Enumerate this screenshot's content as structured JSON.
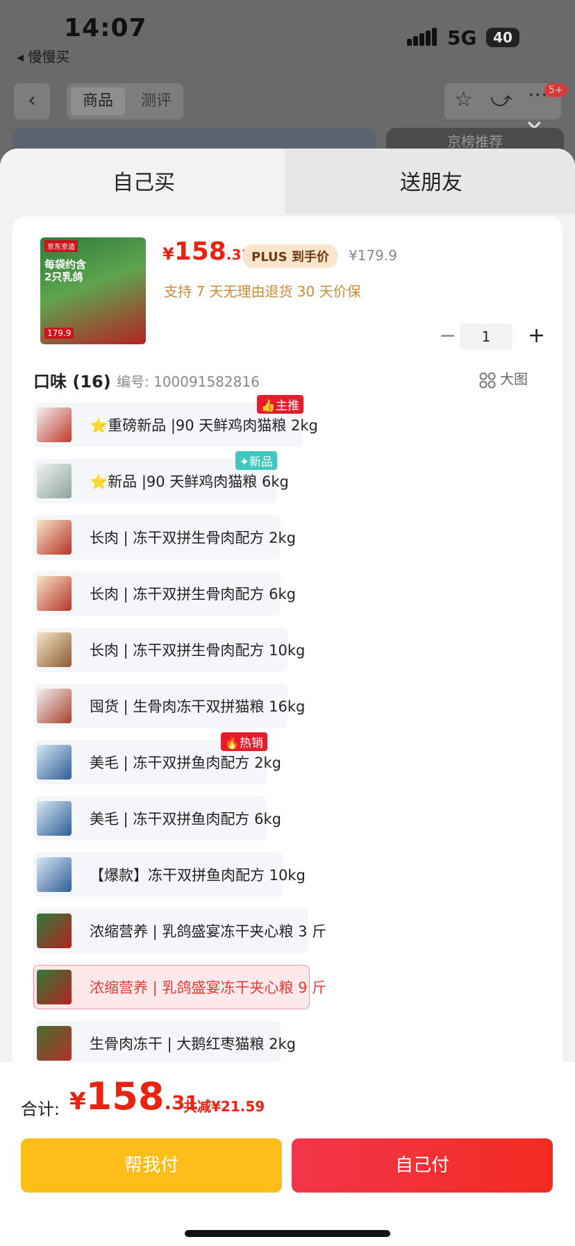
{
  "status": {
    "time": "14:07",
    "back_app": "◂ 慢慢买",
    "network": "5G",
    "battery": "40"
  },
  "header": {
    "tabs": [
      "商品",
      "测评"
    ],
    "badge": "5+",
    "banner_right": "京榜推荐"
  },
  "sheet": {
    "tabs": {
      "self": "自己买",
      "friend": "送朋友"
    },
    "product": {
      "thumb_brand": "京东京造",
      "thumb_headline": "每袋约含2只乳鸽",
      "thumb_price": "179.9",
      "price_currency": "¥",
      "price_int": "158",
      "price_dec": ".31",
      "plus_label": "PLUS 到手价",
      "original_price": "¥179.9",
      "service": "支持 7 天无理由退货   30 天价保",
      "quantity": "1",
      "minus": "−",
      "plus": "+"
    },
    "section": {
      "flavor_label": "口味 (16)",
      "sku_label": "编号:  100091582816",
      "big_image": "大图"
    },
    "options": [
      {
        "label": "⭐重磅新品 |90 天鲜鸡肉猫粮 2kg",
        "tag": "主推",
        "tag_icon": "👍"
      },
      {
        "label": "⭐新品 |90 天鲜鸡肉猫粮 6kg",
        "tag": "新品",
        "tag_icon": "✦"
      },
      {
        "label": "长肉 | 冻干双拼生骨肉配方 2kg"
      },
      {
        "label": "长肉 | 冻干双拼生骨肉配方 6kg"
      },
      {
        "label": "长肉 | 冻干双拼生骨肉配方 10kg"
      },
      {
        "label": "囤货 | 生骨肉冻干双拼猫粮 16kg"
      },
      {
        "label": "美毛 | 冻干双拼鱼肉配方 2kg",
        "tag": "热销",
        "tag_icon": "🔥"
      },
      {
        "label": "美毛 | 冻干双拼鱼肉配方 6kg"
      },
      {
        "label": "【爆款】冻干双拼鱼肉配方 10kg"
      },
      {
        "label": "浓缩营养 | 乳鸽盛宴冻干夹心粮 3 斤"
      },
      {
        "label": "浓缩营养 | 乳鸽盛宴冻干夹心粮 9 斤",
        "selected": true
      },
      {
        "label": "生骨肉冻干 | 大鹅红枣猫粮 2kg"
      }
    ],
    "footer": {
      "total_label": "合计:",
      "currency": "¥",
      "total_int": "158",
      "total_dec": ".31",
      "saved": "共减¥21.59",
      "help_pay": "帮我付",
      "self_pay": "自己付"
    }
  },
  "colors": {
    "accent_red": "#e8230f",
    "help_yellow": "#fdbe1a",
    "pay_red": "#f2364a",
    "plus_bg": "#fbe4cc",
    "service_gold": "#c98a39"
  }
}
